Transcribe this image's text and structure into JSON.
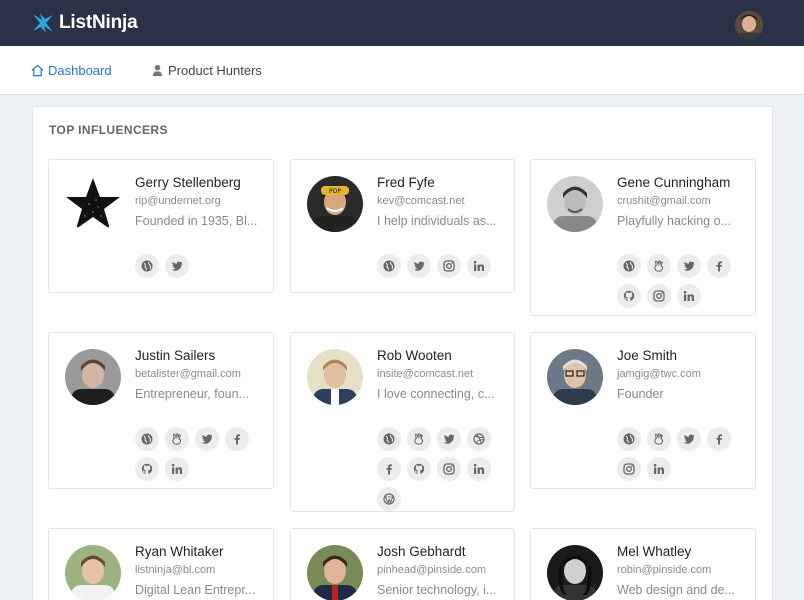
{
  "app": {
    "name": "ListNinja"
  },
  "nav": [
    {
      "label": "Dashboard",
      "icon": "home-icon",
      "active": true
    },
    {
      "label": "Product Hunters",
      "icon": "user-icon",
      "active": false
    }
  ],
  "section": {
    "title": "TOP INFLUENCERS"
  },
  "influencers": [
    {
      "name": "Gerry Stellenberg",
      "email": "rip@undernet.org",
      "bio": "Founded in 1935, Bl...",
      "socials": [
        "globe",
        "twitter"
      ]
    },
    {
      "name": "Fred Fyfe",
      "email": "kev@comcast.net",
      "bio": "I help individuals as...",
      "socials": [
        "globe",
        "twitter",
        "instagram",
        "linkedin"
      ]
    },
    {
      "name": "Gene Cunningham",
      "email": "crushit@gmail.com",
      "bio": "Playfully hacking o...",
      "socials": [
        "globe",
        "angellist",
        "twitter",
        "facebook",
        "github",
        "instagram",
        "linkedin"
      ]
    },
    {
      "name": "Justin Sailers",
      "email": "betalister@gmail.com",
      "bio": "Entrepreneur, foun...",
      "socials": [
        "globe",
        "angellist",
        "twitter",
        "facebook",
        "github",
        "linkedin"
      ]
    },
    {
      "name": "Rob Wooten",
      "email": "insite@comcast.net",
      "bio": "I love connecting, c...",
      "socials": [
        "globe",
        "angellist",
        "twitter",
        "dribbble",
        "facebook",
        "github",
        "instagram",
        "linkedin",
        "wordpress"
      ]
    },
    {
      "name": "Joe Smith",
      "email": "jamgig@twc.com",
      "bio": "Founder",
      "socials": [
        "globe",
        "angellist",
        "twitter",
        "facebook",
        "instagram",
        "linkedin"
      ]
    },
    {
      "name": "Ryan Whitaker",
      "email": "listninja@bl.com",
      "bio": "Digital Lean Entrepr...",
      "socials": []
    },
    {
      "name": "Josh Gebhardt",
      "email": "pinhead@pinside.com",
      "bio": "Senior technology, i...",
      "socials": []
    },
    {
      "name": "Mel Whatley",
      "email": "robin@pinside.com",
      "bio": "Web design and de...",
      "socials": []
    }
  ],
  "colors": {
    "topbar": "#2b3248",
    "accent": "#2874d3",
    "logo": "#2aa7e8"
  }
}
